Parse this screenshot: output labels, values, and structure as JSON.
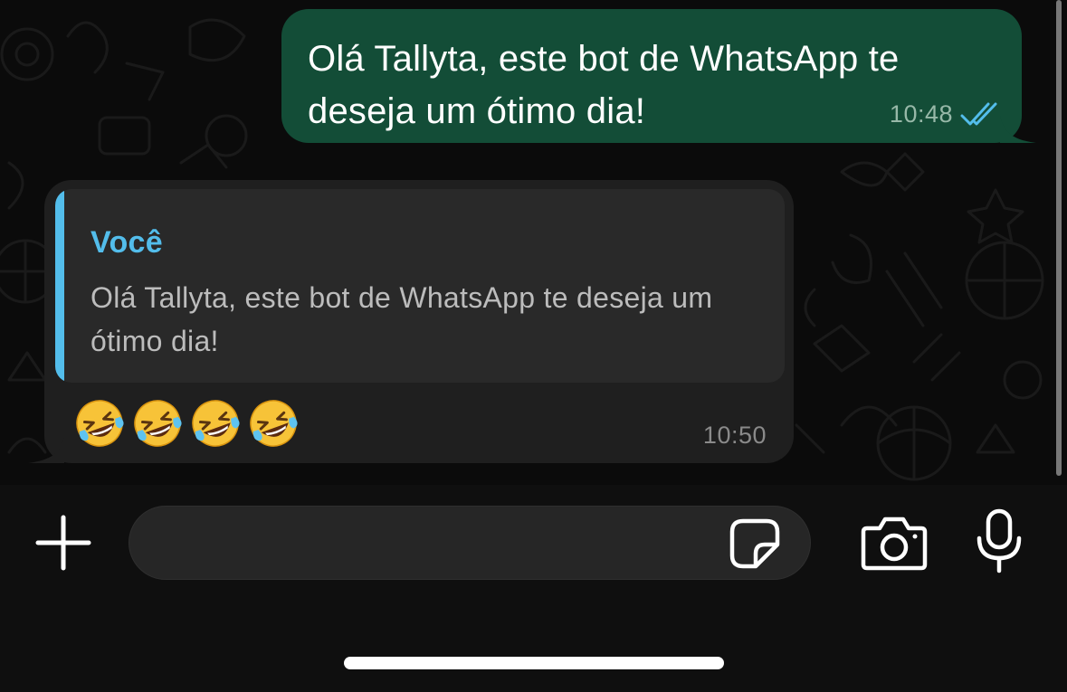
{
  "conversation": {
    "outgoing_message": {
      "text": "Olá Tallyta, este bot de WhatsApp te deseja um ótimo dia!",
      "time": "10:48",
      "status_icon": "double-check-read-icon"
    },
    "incoming_message": {
      "quoted": {
        "author": "Você",
        "text": "Olá Tallyta, este bot de WhatsApp te deseja um ótimo dia!"
      },
      "emoji_icon": "rolling-on-floor-laughing-emoji",
      "emoji_count": 4,
      "time": "10:50"
    }
  },
  "composer": {
    "placeholder": "",
    "icons": {
      "add": "plus-icon",
      "sticker": "sticker-icon",
      "camera": "camera-icon",
      "mic": "microphone-icon"
    }
  },
  "colors": {
    "outgoing_bubble": "#134d37",
    "incoming_bubble": "#1f1f1f",
    "quote_accent": "#53bdeb",
    "read_ticks": "#53bdeb"
  }
}
